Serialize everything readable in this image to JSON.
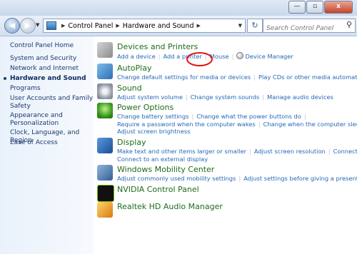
{
  "window": {
    "caption_buttons": {
      "minimize": "—",
      "maximize": "▫",
      "close": "x"
    }
  },
  "address": {
    "back_glyph": "◀",
    "forward_glyph": "▶",
    "breadcrumbs": [
      "Control Panel",
      "Hardware and Sound"
    ],
    "search_placeholder": "Search Control Panel"
  },
  "left_nav": {
    "items": [
      "Control Panel Home",
      "System and Security",
      "Network and Internet",
      "Hardware and Sound",
      "Programs",
      "User Accounts and Family Safety",
      "Appearance and Personalization",
      "Clock, Language, and Region",
      "Ease of Access"
    ],
    "selected": "Hardware and Sound"
  },
  "categories": [
    {
      "title": "Devices and Printers",
      "icon": "printer-icon",
      "links": [
        "Add a device",
        "Add a printer",
        "Mouse",
        "Device Manager"
      ]
    },
    {
      "title": "AutoPlay",
      "icon": "autoplay-icon",
      "links": [
        "Change default settings for media or devices",
        "Play CDs or other media automatically"
      ]
    },
    {
      "title": "Sound",
      "icon": "speaker-icon",
      "links": [
        "Adjust system volume",
        "Change system sounds",
        "Manage audio devices"
      ]
    },
    {
      "title": "Power Options",
      "icon": "power-icon",
      "links": [
        "Change battery settings",
        "Change what the power buttons do",
        "Require a password when the computer wakes",
        "Change when the computer sleeps",
        "Adjust screen brightness"
      ]
    },
    {
      "title": "Display",
      "icon": "display-icon",
      "links": [
        "Make text and other items larger or smaller",
        "Adjust screen resolution",
        "Connect to a projector",
        "Connect to an external display"
      ]
    },
    {
      "title": "Windows Mobility Center",
      "icon": "mobility-center-icon",
      "links": [
        "Adjust commonly used mobility settings",
        "Adjust settings before giving a presentation"
      ]
    },
    {
      "title": "NVIDIA Control Panel",
      "icon": "nvidia-icon",
      "links": []
    },
    {
      "title": "Realtek HD Audio Manager",
      "icon": "realtek-icon",
      "links": []
    }
  ],
  "highlight": {
    "target": "Mouse",
    "color": "#e01010"
  },
  "colors": {
    "link": "#2468b8",
    "heading": "#1d6b1d",
    "nav_text": "#1c3a6e"
  }
}
